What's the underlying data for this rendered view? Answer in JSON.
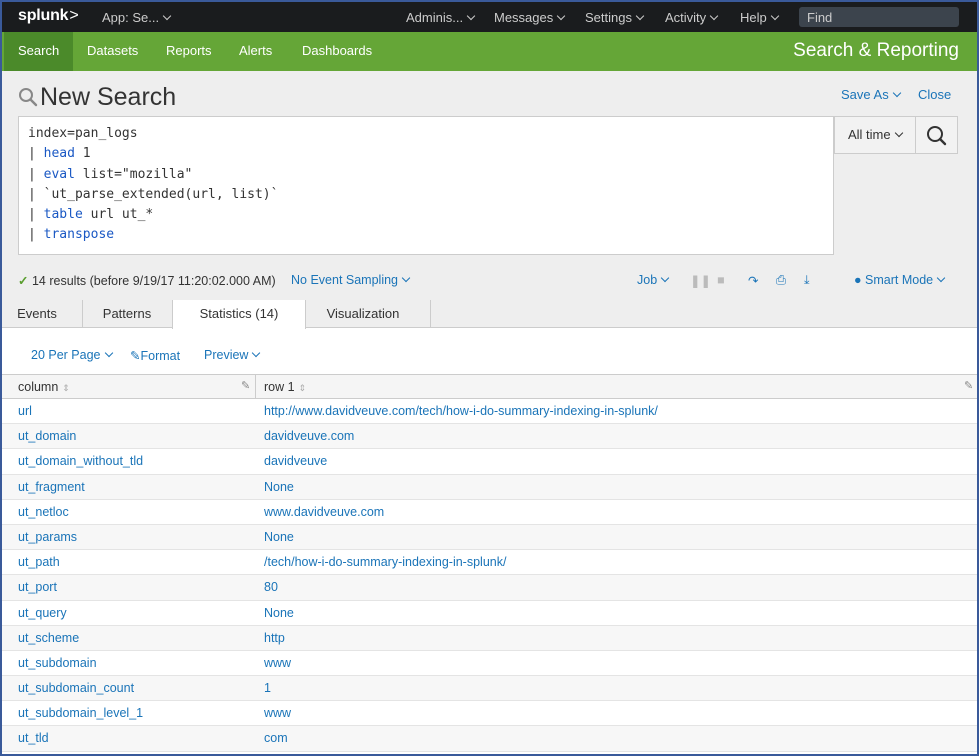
{
  "topbar": {
    "logo": "splunk",
    "logo_mark": ">",
    "app_menu": "App: Se...",
    "menus": [
      "Adminis...",
      "Messages",
      "Settings",
      "Activity",
      "Help"
    ],
    "find_placeholder": "Find"
  },
  "appbar": {
    "nav": [
      "Search",
      "Datasets",
      "Reports",
      "Alerts",
      "Dashboards"
    ],
    "active": "Search",
    "app_title": "Search & Reporting",
    "accent_color": "#65a637"
  },
  "search": {
    "title": "New Search",
    "save_as": "Save As",
    "close": "Close",
    "time_range": "All time",
    "query_lines": [
      {
        "pipe": "",
        "kw": "",
        "rest": "index=pan_logs"
      },
      {
        "pipe": "| ",
        "kw": "head",
        "rest": " 1"
      },
      {
        "pipe": "| ",
        "kw": "eval",
        "rest": " list=\"mozilla\""
      },
      {
        "pipe": "| ",
        "kw": "",
        "rest": "`ut_parse_extended(url, list)`"
      },
      {
        "pipe": "| ",
        "kw": "table",
        "rest": " url ut_*"
      },
      {
        "pipe": "| ",
        "kw": "transpose",
        "rest": ""
      }
    ]
  },
  "status": {
    "results_text": "14 results (before 9/19/17 11:20:02.000 AM)",
    "sampling": "No Event Sampling",
    "job": "Job",
    "mode": "Smart Mode"
  },
  "tabs": [
    "Events",
    "Patterns",
    "Statistics (14)",
    "Visualization"
  ],
  "active_tab": "Statistics (14)",
  "controls": {
    "per_page": "20 Per Page",
    "format": "Format",
    "preview": "Preview"
  },
  "table": {
    "headers": [
      "column",
      "row 1"
    ],
    "rows": [
      [
        "url",
        "http://www.davidveuve.com/tech/how-i-do-summary-indexing-in-splunk/"
      ],
      [
        "ut_domain",
        "davidveuve.com"
      ],
      [
        "ut_domain_without_tld",
        "davidveuve"
      ],
      [
        "ut_fragment",
        "None"
      ],
      [
        "ut_netloc",
        "www.davidveuve.com"
      ],
      [
        "ut_params",
        "None"
      ],
      [
        "ut_path",
        "/tech/how-i-do-summary-indexing-in-splunk/"
      ],
      [
        "ut_port",
        "80"
      ],
      [
        "ut_query",
        "None"
      ],
      [
        "ut_scheme",
        "http"
      ],
      [
        "ut_subdomain",
        "www"
      ],
      [
        "ut_subdomain_count",
        "1"
      ],
      [
        "ut_subdomain_level_1",
        "www"
      ],
      [
        "ut_tld",
        "com"
      ]
    ]
  }
}
